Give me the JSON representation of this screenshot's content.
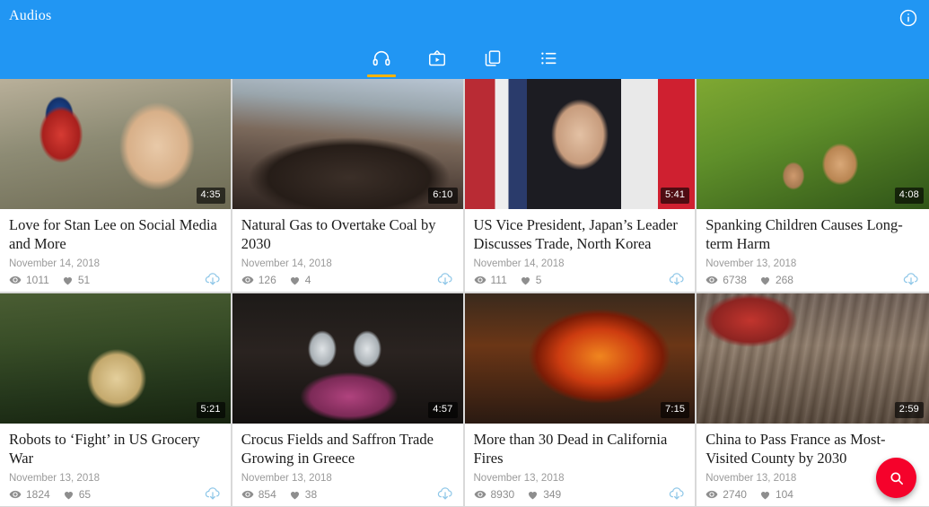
{
  "appbar": {
    "title": "Audios",
    "info_icon": "info-circle-icon",
    "background_color": "#2196f3",
    "tabs": [
      {
        "name": "audios",
        "icon": "headphones-icon",
        "active": true
      },
      {
        "name": "videos",
        "icon": "tv-play-icon",
        "active": false
      },
      {
        "name": "documents",
        "icon": "copy-layers-icon",
        "active": false
      },
      {
        "name": "lists",
        "icon": "list-icon",
        "active": false
      }
    ],
    "active_tab_indicator_color": "#ffb300"
  },
  "fab": {
    "name": "search-fab",
    "icon": "search-icon",
    "color": "#f5022b"
  },
  "cards": [
    {
      "title": "Love for Stan Lee on Social Media and More",
      "date": "November 14, 2018",
      "duration": "4:35",
      "views": "1011",
      "likes": "51",
      "download_icon": "download-cloud-icon"
    },
    {
      "title": "Natural Gas to Overtake Coal by 2030",
      "date": "November 14, 2018",
      "duration": "6:10",
      "views": "126",
      "likes": "4",
      "download_icon": "download-cloud-icon"
    },
    {
      "title": "US Vice President, Japan’s Leader Discusses Trade, North Korea",
      "date": "November 14, 2018",
      "duration": "5:41",
      "views": "111",
      "likes": "5",
      "download_icon": "download-cloud-icon"
    },
    {
      "title": "Spanking Children Causes Long-term Harm",
      "date": "November 13, 2018",
      "duration": "4:08",
      "views": "6738",
      "likes": "268",
      "download_icon": "download-cloud-icon"
    },
    {
      "title": "Robots to ‘Fight’ in US Grocery War",
      "date": "November 13, 2018",
      "duration": "5:21",
      "views": "1824",
      "likes": "65",
      "download_icon": "download-cloud-icon"
    },
    {
      "title": "Crocus Fields and Saffron Trade Growing in Greece",
      "date": "November 13, 2018",
      "duration": "4:57",
      "views": "854",
      "likes": "38",
      "download_icon": "download-cloud-icon"
    },
    {
      "title": "More than 30 Dead in California Fires",
      "date": "November 13, 2018",
      "duration": "7:15",
      "views": "8930",
      "likes": "349",
      "download_icon": "download-cloud-icon"
    },
    {
      "title": "China to Pass France as Most-Visited County by 2030",
      "date": "November 13, 2018",
      "duration": "2:59",
      "views": "2740",
      "likes": "104",
      "download_icon": "download-cloud-icon"
    }
  ]
}
